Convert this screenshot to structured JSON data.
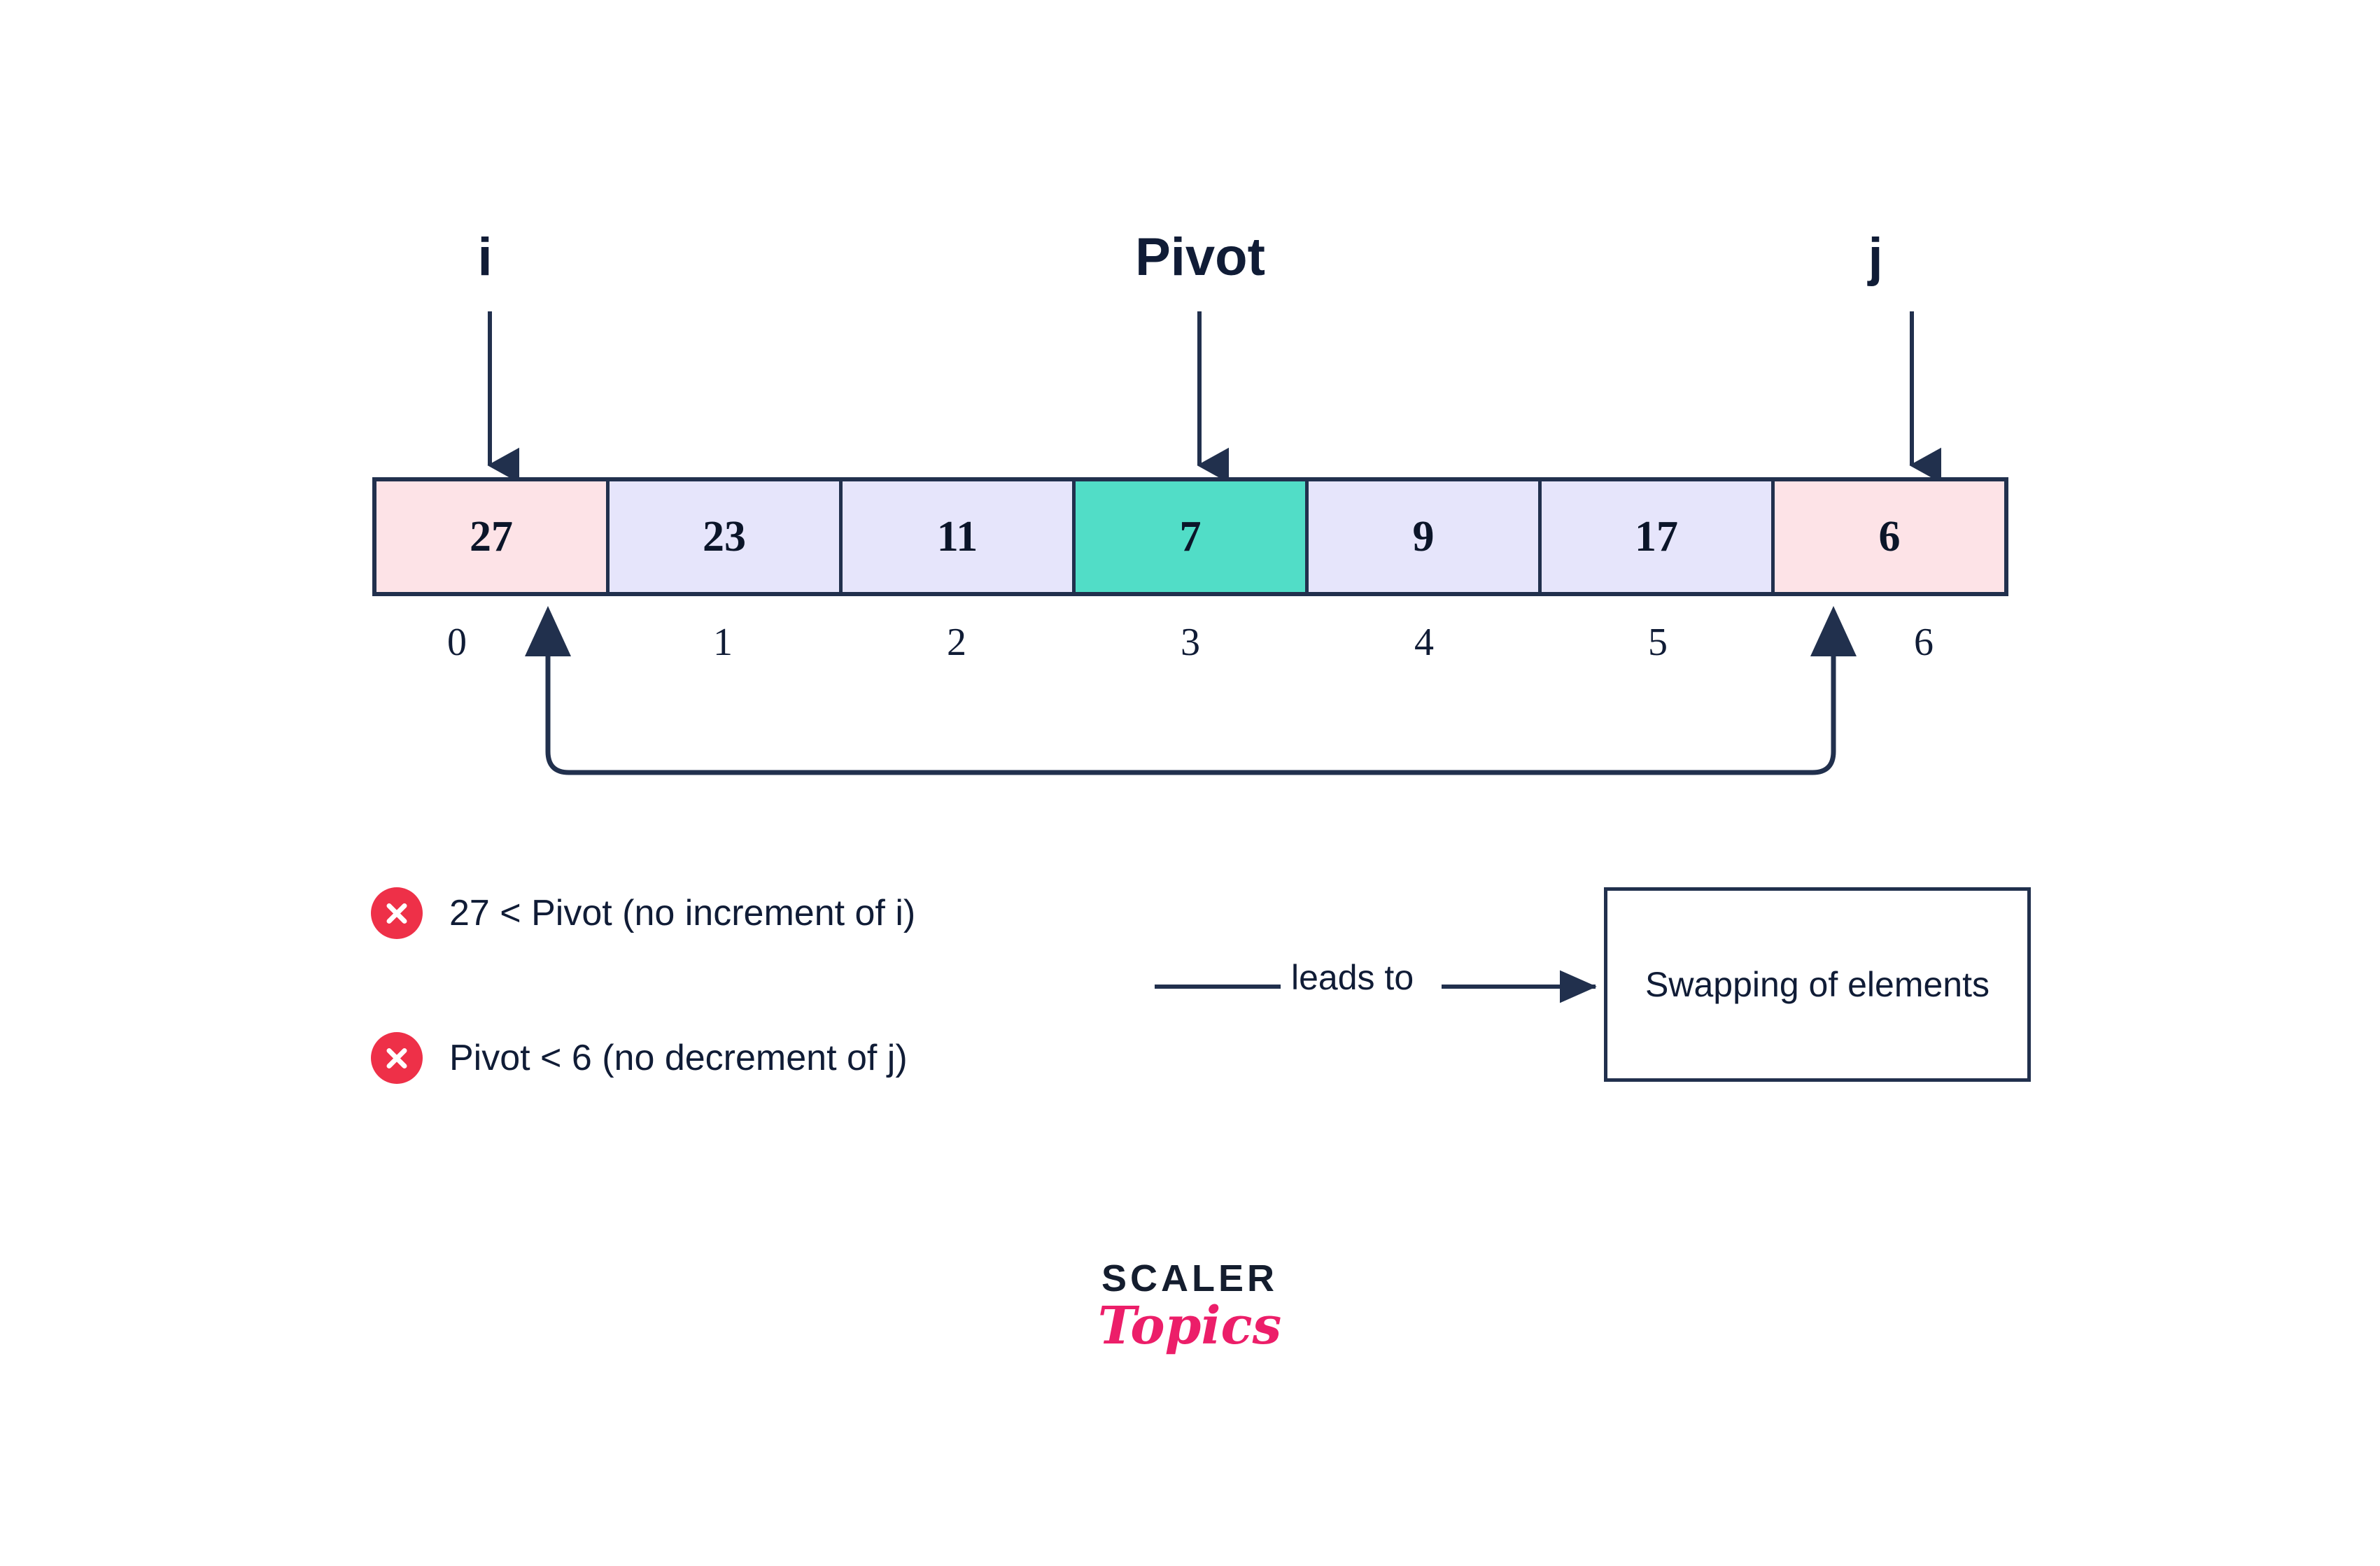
{
  "diagram": {
    "pointers": {
      "i_label": "i",
      "pivot_label": "Pivot",
      "j_label": "j"
    },
    "array": {
      "values": [
        "27",
        "23",
        "11",
        "7",
        "9",
        "17",
        "6"
      ],
      "indices": [
        "0",
        "1",
        "2",
        "3",
        "4",
        "5",
        "6"
      ],
      "cell_colors": [
        "pink",
        "lilac",
        "lilac",
        "teal",
        "lilac",
        "lilac",
        "pink"
      ],
      "pivot_index": 3,
      "i_index": 0,
      "j_index": 6
    },
    "statements": [
      {
        "icon": "cross-circle-icon",
        "text": "27 < Pivot (no increment of i)"
      },
      {
        "icon": "cross-circle-icon",
        "text": "Pivot < 6 (no decrement of j)"
      }
    ],
    "flow": {
      "leads_to_label": "leads to",
      "result_box_text": "Swapping of elements"
    },
    "logo": {
      "primary": "SCALER",
      "secondary": "Topics"
    },
    "colors": {
      "ink": "#101c36",
      "border": "#21304d",
      "pink_cell": "#fde3e7",
      "lilac_cell": "#e6e5fb",
      "teal_cell": "#51ddc7",
      "cross_red": "#ee3048",
      "logo_pink": "#ec1e69",
      "background": "#ffffff"
    }
  }
}
